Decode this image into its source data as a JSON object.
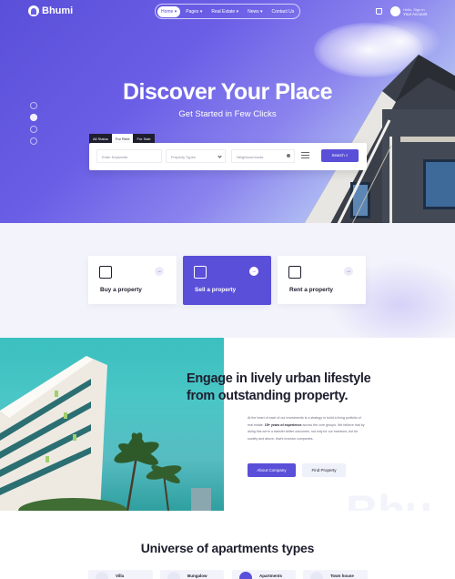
{
  "brand": {
    "name": "Bhumi"
  },
  "nav": {
    "items": [
      {
        "label": "Home",
        "active": true
      },
      {
        "label": "Pages"
      },
      {
        "label": "Real Estate"
      },
      {
        "label": "News"
      },
      {
        "label": "Contact Us"
      }
    ],
    "user": {
      "greeting": "Hello, Sign in",
      "account": "Your Account"
    }
  },
  "hero": {
    "title": "Discover Your Place",
    "subtitle": "Get Started in Few Clicks"
  },
  "search": {
    "tabs": [
      "All Status",
      "For Rent",
      "For Sale"
    ],
    "active_tab": "For Rent",
    "keyword_placeholder": "Enter Keywords",
    "property_type": "Property Types",
    "neighbourhood_placeholder": "Neighbourhoods",
    "search_label": "Search"
  },
  "actions": {
    "buy": "Buy a property",
    "sell": "Sell a property",
    "rent": "Rent a property"
  },
  "engage": {
    "heading_line1": "Engage in lively urban lifestyle",
    "heading_line2": "from outstanding property.",
    "para_a": "At the heart of each of our investments is a strategy to build a living portfolio of real estate.",
    "para_bold": "15+ years of experience",
    "para_b": "across the core groups. We believe that by doing this we're a transfer better outcomes, not only for our investors, but for society and above, that's investor companies.",
    "about_label": "About Company",
    "find_label": "Find Property",
    "watermark": "Bhu"
  },
  "universe": {
    "title": "Universe of apartments types",
    "types": [
      "Villa",
      "Bungalow",
      "Apartments",
      "Town house"
    ]
  },
  "colors": {
    "accent": "#5a4fd8",
    "dark": "#1e1e2e",
    "soft": "#f3f4fb"
  }
}
